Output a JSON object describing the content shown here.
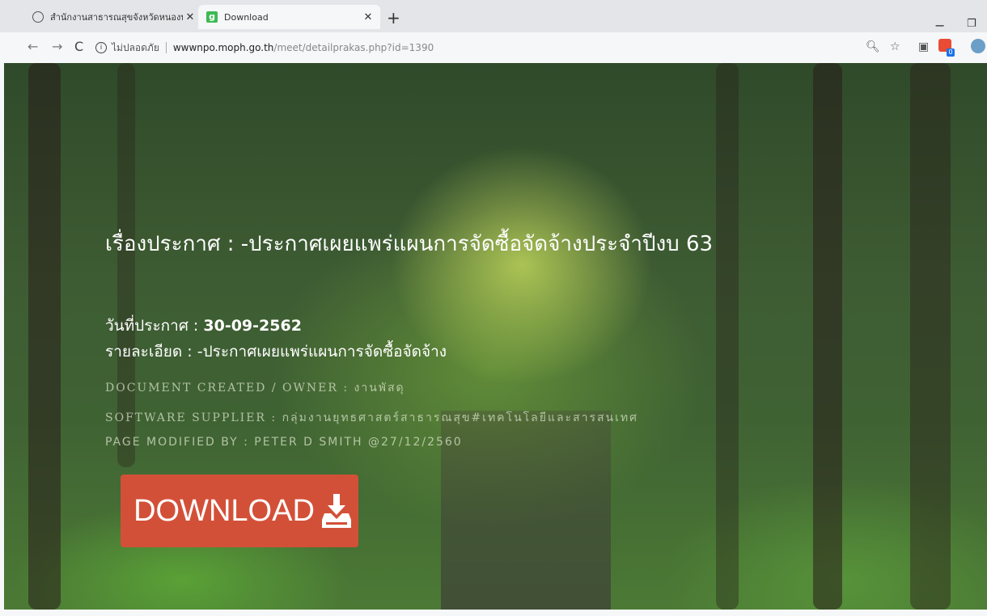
{
  "browser": {
    "tabs": [
      {
        "title": "สำนักงานสาธารณสุขจังหวัดหนองบัวลำ"
      },
      {
        "title": "Download",
        "favicon_letter": "g"
      }
    ],
    "address": {
      "security_label": "ไม่ปลอดภัย",
      "host": "wwwnpo.moph.go.th",
      "path": "/meet/detailprakas.php?id=1390"
    }
  },
  "page": {
    "headline": "เรื่องประกาศ : -ประกาศเผยแพร่แผนการจัดซื้อจัดจ้างประจำปีงบ 63",
    "date_label": "วันที่ประกาศ : ",
    "date_value": "30-09-2562",
    "detail_label": "รายละเอียด : ",
    "detail_value": "-ประกาศเผยแพร่แผนการจัดซื้อจัดจ้าง",
    "created_owner": "DOCUMENT CREATED / OWNER : งานพัสดุ",
    "software_supplier": "SOFTWARE SUPPLIER : กลุ่มงานยุทธศาสตร์สาธารณสุข#เทคโนโลยีและสารสนเทศ",
    "modified_by": "PAGE MODIFIED BY : PETER D SMITH @27/12/2560",
    "download_label": "DOWNLOAD"
  },
  "colors": {
    "download_button": "#d35038",
    "text": "#ffffff"
  }
}
